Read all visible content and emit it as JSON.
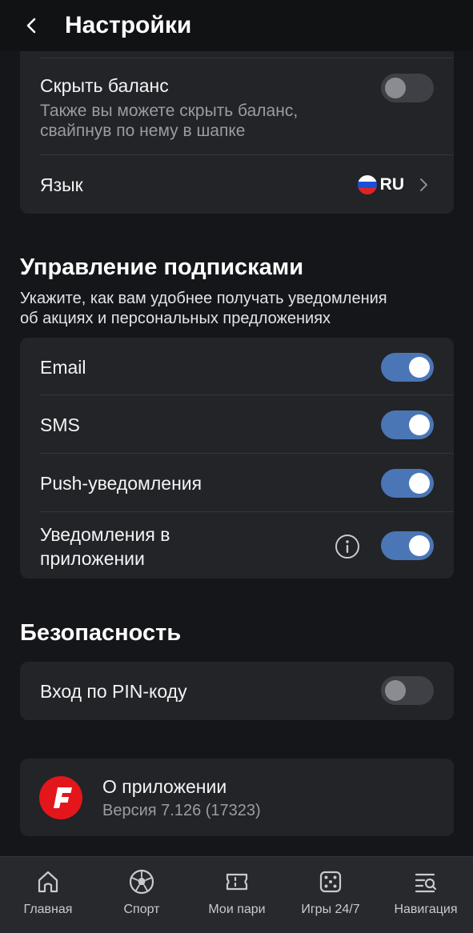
{
  "header": {
    "title": "Настройки"
  },
  "settings_card": {
    "hide_balance": {
      "label": "Скрыть баланс",
      "description_line1": "Также вы можете скрыть баланс,",
      "description_line2": "свайпнув по нему в шапке",
      "enabled": false
    },
    "language": {
      "label": "Язык",
      "value": "RU"
    }
  },
  "subscriptions": {
    "title": "Управление подписками",
    "description_line1": "Укажите, как вам удобнее получать уведомления",
    "description_line2": "об акциях и персональных предложениях",
    "items": [
      {
        "label": "Email",
        "enabled": true
      },
      {
        "label": "SMS",
        "enabled": true
      },
      {
        "label": "Push-уведомления",
        "enabled": true
      },
      {
        "label_line1": "Уведомления в",
        "label_line2": "приложении",
        "enabled": true
      }
    ]
  },
  "security": {
    "title": "Безопасность",
    "pin_login": {
      "label": "Вход по PIN-коду",
      "enabled": false
    }
  },
  "about": {
    "title": "О приложении",
    "version": "Версия 7.126 (17323)"
  },
  "tabbar": {
    "items": [
      {
        "label": "Главная",
        "icon": "home-icon"
      },
      {
        "label": "Спорт",
        "icon": "soccer-ball-icon"
      },
      {
        "label": "Мои пари",
        "icon": "ticket-icon"
      },
      {
        "label": "Игры 24/7",
        "icon": "dice-icon"
      },
      {
        "label": "Навигация",
        "icon": "menu-search-icon"
      }
    ]
  },
  "colors": {
    "background": "#151619",
    "card": "#222428",
    "toggle_on": "#4a76b6",
    "toggle_off": "#3e4045",
    "brand_red": "#e3161c"
  }
}
